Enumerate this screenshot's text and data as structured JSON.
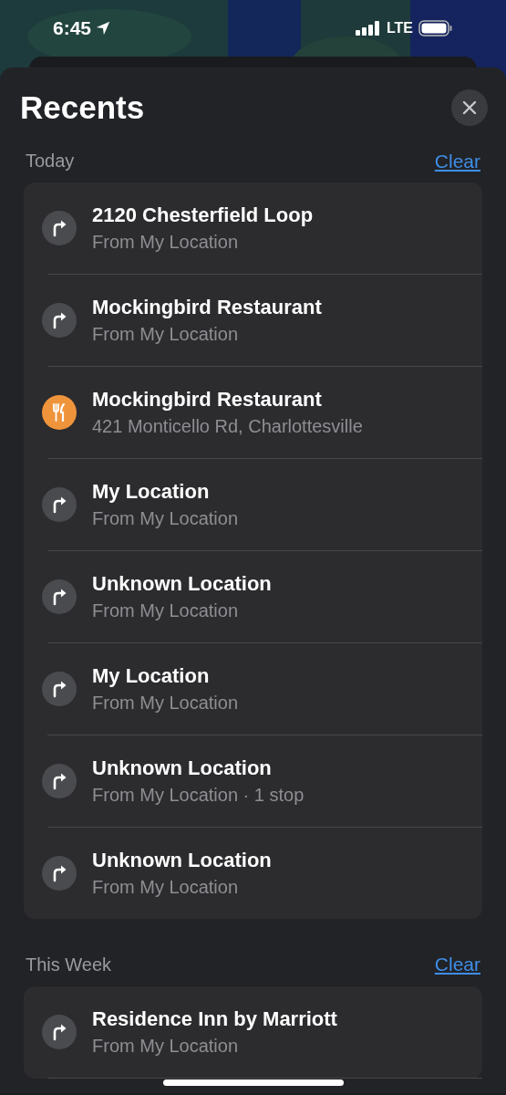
{
  "status_bar": {
    "time": "6:45",
    "network": "LTE"
  },
  "sheet": {
    "title": "Recents"
  },
  "sections": [
    {
      "heading": "Today",
      "action": "Clear",
      "items": [
        {
          "kind": "directions",
          "title": "2120 Chesterfield Loop",
          "subtitle": "From My Location"
        },
        {
          "kind": "directions",
          "title": "Mockingbird Restaurant",
          "subtitle": "From My Location"
        },
        {
          "kind": "restaurant",
          "title": "Mockingbird Restaurant",
          "subtitle": "421 Monticello Rd, Charlottesville"
        },
        {
          "kind": "directions",
          "title": "My Location",
          "subtitle": "From My Location"
        },
        {
          "kind": "directions",
          "title": "Unknown Location",
          "subtitle": "From My Location"
        },
        {
          "kind": "directions",
          "title": "My Location",
          "subtitle": "From My Location"
        },
        {
          "kind": "directions",
          "title": "Unknown Location",
          "subtitle": "From My Location · 1 stop"
        },
        {
          "kind": "directions",
          "title": "Unknown Location",
          "subtitle": "From My Location"
        }
      ]
    },
    {
      "heading": "This Week",
      "action": "Clear",
      "items": [
        {
          "kind": "directions",
          "title": "Residence Inn by Marriott",
          "subtitle": "From My Location"
        }
      ]
    }
  ]
}
